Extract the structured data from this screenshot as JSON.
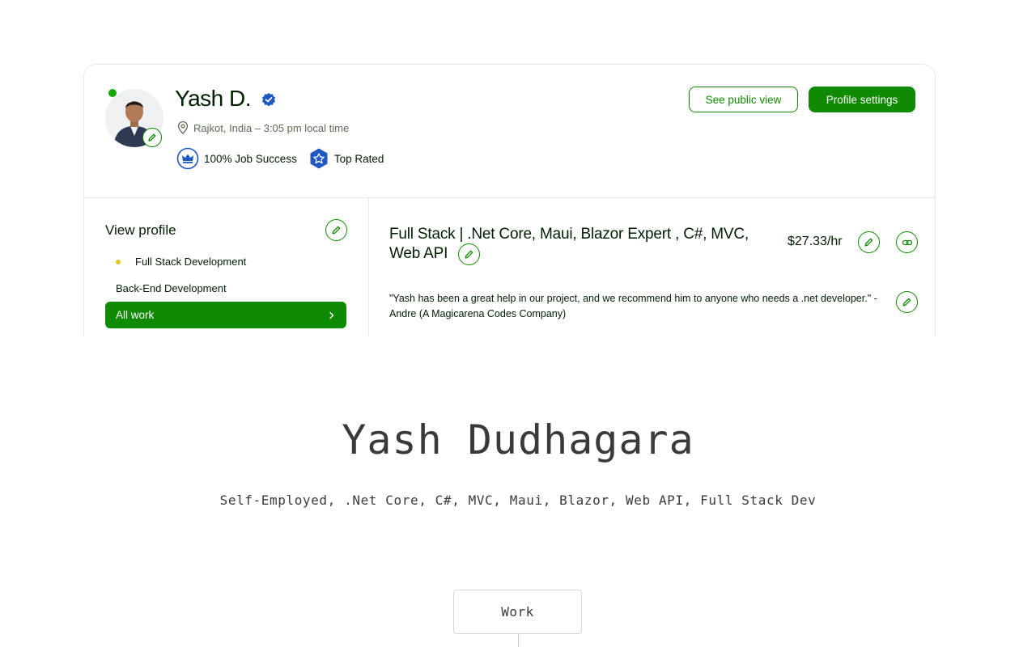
{
  "profile": {
    "name": "Yash D.",
    "location": "Rajkot, India – 3:05 pm local time",
    "badges": {
      "job_success": "100% Job Success",
      "top_rated": "Top Rated"
    },
    "buttons": {
      "public_view": "See public view",
      "settings": "Profile settings"
    }
  },
  "sidebar": {
    "title": "View profile",
    "items": [
      {
        "label": "Full Stack Development"
      },
      {
        "label": "Back-End Development"
      }
    ],
    "all_work": "All work"
  },
  "main": {
    "headline": "Full Stack | .Net Core, Maui, Blazor Expert , C#, MVC, Web API",
    "rate": "$27.33/hr",
    "quote": "\"Yash has been a great help in our project, and we recommend him to anyone who needs a .net developer.\" - Andre (A Magicarena Codes Company)"
  },
  "page": {
    "full_name": "Yash Dudhagara",
    "subtitle": "Self-Employed, .Net Core, C#, MVC, Maui, Blazor, Web API, Full Stack Dev",
    "work_label": "Work"
  },
  "colors": {
    "accent": "#108a00",
    "online": "#14a800",
    "verified": "#1f57c3",
    "badge_dot": "#e5c620"
  },
  "icons": [
    "pencil-icon",
    "verified-icon",
    "location-pin-icon",
    "crown-icon",
    "star-badge-icon",
    "link-icon",
    "chevron-right-icon"
  ]
}
